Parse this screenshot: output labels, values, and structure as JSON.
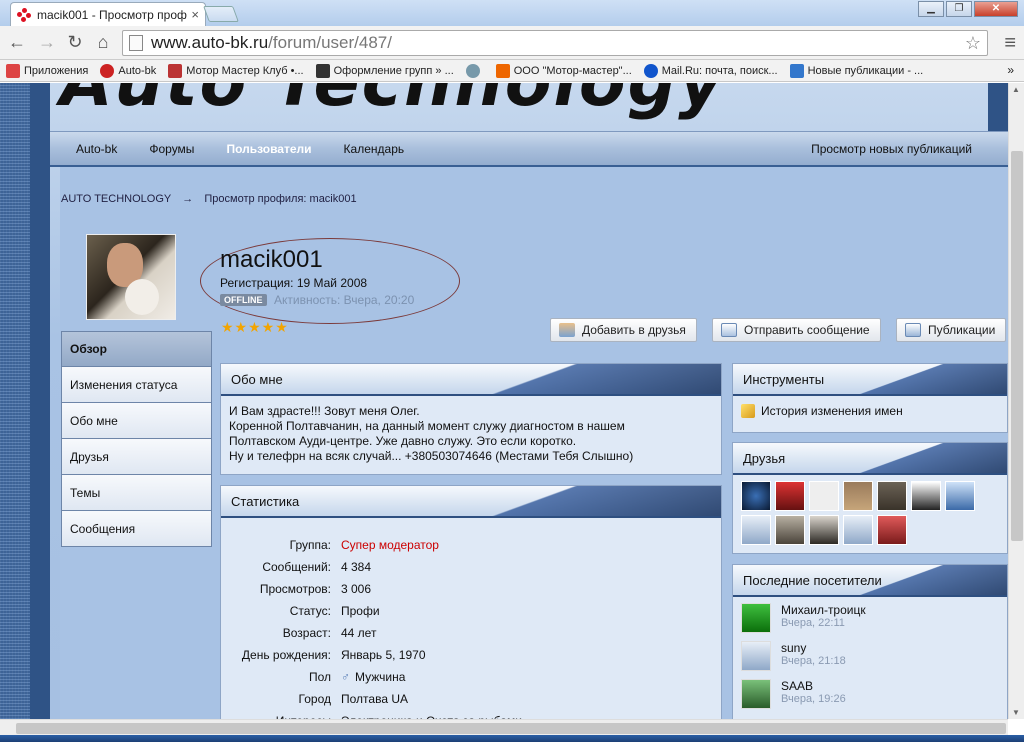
{
  "browser": {
    "tab_title": "macik001 - Просмотр профи",
    "url_host": "www.auto-bk.ru",
    "url_path": "/forum/user/487/",
    "window_controls": [
      "minimize-icon",
      "maximize-icon",
      "close-icon"
    ],
    "bookmarks": [
      {
        "label": "Приложения",
        "color": "#d44"
      },
      {
        "label": "Auto-bk",
        "color": "#c22"
      },
      {
        "label": "Мотор Мастер Клуб •...",
        "color": "#b33"
      },
      {
        "label": "Оформление групп » ...",
        "color": "#333"
      },
      {
        "label": "",
        "color": "#79a"
      },
      {
        "label": "ООО \"Мотор-мастер\"...",
        "color": "#e60"
      },
      {
        "label": "Mail.Ru: почта, поиск...",
        "color": "#15c"
      },
      {
        "label": "Новые публикации - ...",
        "color": "#37c"
      }
    ],
    "bookmarks_more": "»"
  },
  "site": {
    "logo_text": "Auto Technology",
    "nav": [
      "Auto-bk",
      "Форумы",
      "Пользователи",
      "Календарь"
    ],
    "nav_right": "Просмотр новых публикаций",
    "breadcrumb": [
      "AUTO TECHNOLOGY",
      "→",
      "Просмотр профиля: macik001"
    ]
  },
  "profile": {
    "name": "macik001",
    "registration": "Регистрация: 19 Май 2008",
    "status_badge": "OFFLINE",
    "activity": "Активность: Вчера, 20:20",
    "stars": "★★★★★",
    "buttons": [
      "Добавить в друзья",
      "Отправить сообщение",
      "Публикации"
    ]
  },
  "sidenav": [
    "Обзор",
    "Изменения статуса",
    "Обо мне",
    "Друзья",
    "Темы",
    "Сообщения"
  ],
  "about": {
    "title": "Обо мне",
    "lines": [
      "И Вам здрасте!!! Зовут меня Олег.",
      "Коренной Полтавчанин, на данный момент служу диагностом в нашем",
      "Полтавском Ауди-центре. Уже давно служу. Это если коротко.",
      "Ну и телефрн на всяк случай... +380503074646 (Местами Тебя Слышно)"
    ]
  },
  "stats": {
    "title": "Статистика",
    "rows": [
      {
        "k": "Группа:",
        "v": "Супер модератор"
      },
      {
        "k": "Сообщений:",
        "v": "4 384"
      },
      {
        "k": "Просмотров:",
        "v": "3 006"
      },
      {
        "k": "Статус:",
        "v": "Профи"
      },
      {
        "k": "Возраст:",
        "v": "44 лет"
      },
      {
        "k": "День рождения:",
        "v": "Январь 5, 1970"
      },
      {
        "k": "Пол",
        "v": "Мужчина"
      },
      {
        "k": "Город",
        "v": "Полтава UA"
      },
      {
        "k": "Интересы",
        "v": "Электроника и Охота за рыбами"
      }
    ]
  },
  "tools": {
    "title": "Инструменты",
    "item": "История изменения имен"
  },
  "friends": {
    "title": "Друзья"
  },
  "visitors": {
    "title": "Последние посетители",
    "items": [
      {
        "name": "Михаил-троицк",
        "time": "Вчера, 22:11"
      },
      {
        "name": "suny",
        "time": "Вчера, 21:18"
      },
      {
        "name": "SAAB",
        "time": "Вчера, 19:26"
      }
    ]
  }
}
